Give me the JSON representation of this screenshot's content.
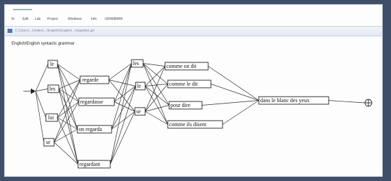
{
  "window": {
    "menu": [
      {
        "id": "file",
        "label": "fe"
      },
      {
        "id": "edit",
        "label": "Edit"
      },
      {
        "id": "lab",
        "label": "Lab"
      },
      {
        "id": "project",
        "label": "Project"
      },
      {
        "id": "windows",
        "label": "Windows"
      },
      {
        "id": "info",
        "label": "Info"
      },
      {
        "id": "grammar",
        "label": "GRAMMAR"
      }
    ],
    "path": "C:\\Users\\...\\Unitex\\...\\English\\Graphs\\...\\regardez.grf",
    "subtitle": "English/English syntactic grammar"
  },
  "graph": {
    "nodes": [
      {
        "id": "le",
        "label": "le"
      },
      {
        "id": "les",
        "label": "les"
      },
      {
        "id": "lui",
        "label": "lui"
      },
      {
        "id": "se",
        "label": "se"
      },
      {
        "id": "regarde",
        "label": "regarde"
      },
      {
        "id": "regardasse",
        "label": "regardasse"
      },
      {
        "id": "on_regarda",
        "label": "on regarda"
      },
      {
        "id": "regardant",
        "label": "regardant"
      },
      {
        "id": "les2",
        "label": "les"
      },
      {
        "id": "le2",
        "label": "le"
      },
      {
        "id": "se2",
        "label": "se"
      },
      {
        "id": "comme_on_dit",
        "label": "comme on dit"
      },
      {
        "id": "comme_le_dit",
        "label": "comme le dit"
      },
      {
        "id": "pour_dire",
        "label": "pour dire"
      },
      {
        "id": "comme_ils_disent",
        "label": "comme ils disent"
      },
      {
        "id": "dans_le_blanc",
        "label": "dans le blanc des yeux"
      }
    ],
    "edges": [
      [
        "start",
        "le"
      ],
      [
        "start",
        "les"
      ],
      [
        "start",
        "lui"
      ],
      [
        "start",
        "se"
      ],
      [
        "le",
        "regarde"
      ],
      [
        "le",
        "regardasse"
      ],
      [
        "le",
        "on_regarda"
      ],
      [
        "le",
        "regardant"
      ],
      [
        "les",
        "regarde"
      ],
      [
        "les",
        "regardasse"
      ],
      [
        "les",
        "on_regarda"
      ],
      [
        "les",
        "regardant"
      ],
      [
        "lui",
        "regarde"
      ],
      [
        "lui",
        "regardasse"
      ],
      [
        "lui",
        "on_regarda"
      ],
      [
        "lui",
        "regardant"
      ],
      [
        "se",
        "regarde"
      ],
      [
        "se",
        "regardasse"
      ],
      [
        "se",
        "on_regarda"
      ],
      [
        "se",
        "regardant"
      ],
      [
        "regarde",
        "les2"
      ],
      [
        "regarde",
        "le2"
      ],
      [
        "regarde",
        "se2"
      ],
      [
        "regardasse",
        "les2"
      ],
      [
        "regardasse",
        "le2"
      ],
      [
        "regardasse",
        "se2"
      ],
      [
        "on_regarda",
        "les2"
      ],
      [
        "on_regarda",
        "le2"
      ],
      [
        "on_regarda",
        "se2"
      ],
      [
        "regardant",
        "les2"
      ],
      [
        "regardant",
        "le2"
      ],
      [
        "regardant",
        "se2"
      ],
      [
        "les2",
        "comme_on_dit"
      ],
      [
        "les2",
        "comme_le_dit"
      ],
      [
        "les2",
        "pour_dire"
      ],
      [
        "les2",
        "comme_ils_disent"
      ],
      [
        "le2",
        "comme_on_dit"
      ],
      [
        "le2",
        "comme_le_dit"
      ],
      [
        "le2",
        "pour_dire"
      ],
      [
        "le2",
        "comme_ils_disent"
      ],
      [
        "se2",
        "comme_on_dit"
      ],
      [
        "se2",
        "comme_le_dit"
      ],
      [
        "se2",
        "pour_dire"
      ],
      [
        "se2",
        "comme_ils_disent"
      ],
      [
        "comme_on_dit",
        "dans_le_blanc"
      ],
      [
        "comme_le_dit",
        "dans_le_blanc"
      ],
      [
        "pour_dire",
        "dans_le_blanc"
      ],
      [
        "comme_ils_disent",
        "dans_le_blanc"
      ],
      [
        "dans_le_blanc",
        "end"
      ]
    ]
  }
}
